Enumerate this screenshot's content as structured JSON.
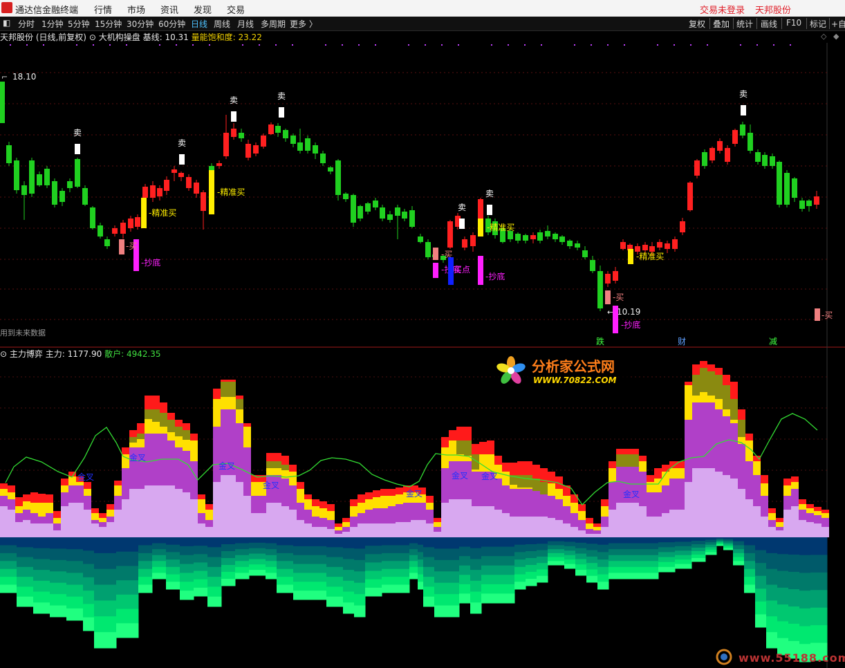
{
  "app": {
    "title": "通达信金融终端"
  },
  "menu": {
    "items": [
      "行情",
      "市场",
      "资讯",
      "发现",
      "交易"
    ],
    "status_login": "交易未登录",
    "stock": "天邦股份"
  },
  "periods": {
    "tabs": [
      "分时",
      "1分钟",
      "5分钟",
      "15分钟",
      "30分钟",
      "60分钟",
      "日线",
      "周线",
      "月线",
      "多周期",
      "更多 〉"
    ],
    "active": "日线"
  },
  "toolbar_right": [
    "复权",
    "叠加",
    "统计",
    "画线",
    "F10",
    "标记",
    "+自"
  ],
  "main_chart": {
    "stock_label": "天邦股份 (日线,前复权)",
    "indicator_name": "大机构操盘",
    "baseline_label": "基线:",
    "baseline_value": "10.31",
    "saturation_label": "量能饱和度:",
    "saturation_value": "23.22",
    "high_label": "18.10",
    "low_label": "10.19",
    "future_data_note": "用到未来数据",
    "sell_label": "卖",
    "precise_buy_label": "精准买",
    "buy_label": "买",
    "bottom_label": "抄底",
    "buy_point_label": "买点",
    "event_labels": [
      "跌",
      "财",
      "减"
    ]
  },
  "sub_chart": {
    "indicator_name": "主力博弈",
    "main_force_label": "主力:",
    "main_force_value": "1177.90",
    "retail_label": "散户:",
    "retail_value": "4942.35",
    "golden_cross_label": "金叉"
  },
  "watermark": {
    "title": "分析家公式网",
    "url": "WWW.70822.COM",
    "site": "www.55188.com"
  },
  "colors": {
    "up": "#ff2020",
    "down": "#20d020",
    "precise_buy": "#ffee00",
    "bottom": "#ff20ff",
    "buy": "#f08080",
    "buy_point": "#1020ff",
    "main_line": "#33dd33"
  }
}
